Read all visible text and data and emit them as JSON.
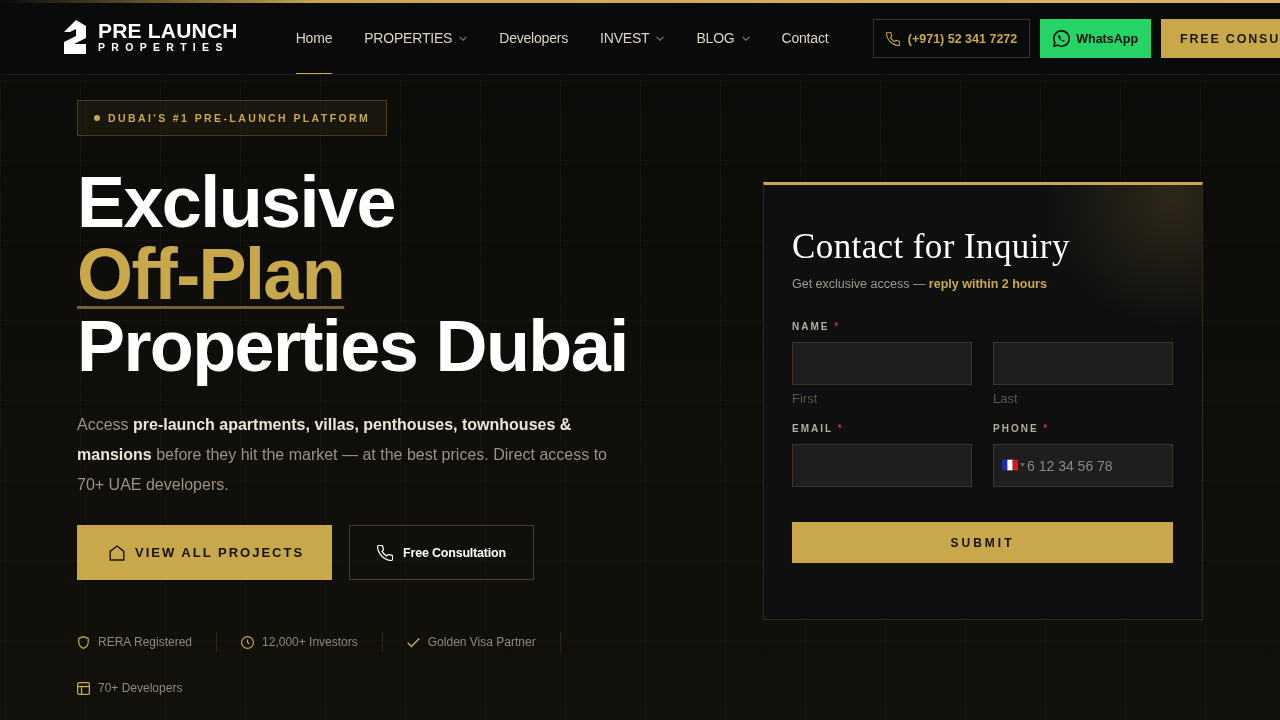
{
  "header": {
    "logo": {
      "line_1": "PRE LAUNCH",
      "line_2": "PROPERTIES"
    },
    "nav": [
      {
        "label": "Home",
        "selected": true,
        "dropdown": false
      },
      {
        "label": "PROPERTIES",
        "selected": false,
        "dropdown": true
      },
      {
        "label": "Developers",
        "selected": false,
        "dropdown": false
      },
      {
        "label": "INVEST",
        "selected": false,
        "dropdown": true
      },
      {
        "label": "BLOG",
        "selected": false,
        "dropdown": true
      },
      {
        "label": "Contact",
        "selected": false,
        "dropdown": false
      }
    ],
    "actions": [
      {
        "kind": "phone",
        "label": "(+971) 52 341 7272"
      },
      {
        "kind": "whatsapp",
        "label": "WhatsApp"
      },
      {
        "kind": "cta",
        "label": "FREE CONSU"
      }
    ]
  },
  "hero": {
    "badge": "DUBAI'S #1 PRE-LAUNCH PLATFORM",
    "title": [
      {
        "text": "Exclusive",
        "kind": "plain"
      },
      {
        "text": "Off-Plan",
        "kind": "accent"
      },
      {
        "text": "Properties Dubai",
        "kind": "plain"
      }
    ],
    "lead": "Access **pre-launch apartments, villas, penthouses, townhouses & mansions** before they hit the market — at the best prices. Direct access to 70+ UAE developers.",
    "buttons": [
      {
        "kind": "primary",
        "label": "VIEW ALL PROJECTS"
      },
      {
        "kind": "outline",
        "label": "Free Consultation"
      }
    ],
    "trust": [
      {
        "kind": "shield",
        "label": "RERA Registered"
      },
      {
        "kind": "clock",
        "label": "12,000+ Investors"
      },
      {
        "kind": "check",
        "label": "Golden Visa Partner"
      },
      {
        "kind": "layout",
        "label": "70+ Developers"
      }
    ]
  },
  "form": {
    "title": "Contact for Inquiry",
    "subtitle": "Get exclusive access — **reply within 2 hours**",
    "fields": [
      {
        "kind": "text",
        "label": "NAME",
        "required_mark": "*",
        "sublabel": "First"
      },
      {
        "kind": "text",
        "sublabel": "Last"
      },
      {
        "kind": "text",
        "label": "EMAIL",
        "required_mark": "*"
      },
      {
        "kind": "phone",
        "label": "PHONE",
        "required_mark": "*",
        "placeholder": "6 12 34 56 78"
      }
    ],
    "submit": "SUBMIT"
  }
}
